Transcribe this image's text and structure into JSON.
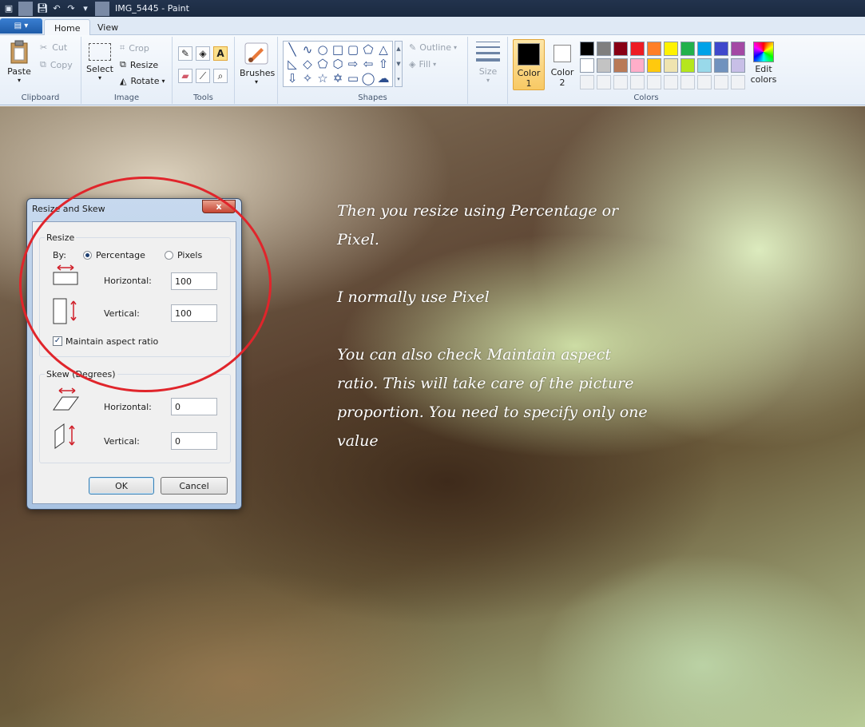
{
  "window": {
    "title": "IMG_5445 - Paint"
  },
  "tabs": [
    {
      "label": "Home"
    },
    {
      "label": "View"
    }
  ],
  "ribbon": {
    "clipboard": {
      "label": "Clipboard",
      "paste": "Paste",
      "cut": "Cut",
      "copy": "Copy"
    },
    "image": {
      "label": "Image",
      "select": "Select",
      "crop": "Crop",
      "resize": "Resize",
      "rotate": "Rotate"
    },
    "tools": {
      "label": "Tools"
    },
    "brushes": {
      "label": "Brushes"
    },
    "shapes": {
      "label": "Shapes",
      "outline": "Outline",
      "fill": "Fill"
    },
    "size": {
      "label": "Size"
    },
    "colors": {
      "label": "Colors",
      "color1": "Color",
      "color1_num": "1",
      "color2": "Color",
      "color2_num": "2",
      "edit": "Edit",
      "edit2": "colors",
      "row1": [
        "#000000",
        "#7f7f7f",
        "#880015",
        "#ed1c24",
        "#ff7f27",
        "#fff200",
        "#22b14c",
        "#00a2e8",
        "#3f48cc",
        "#a349a4"
      ],
      "row2": [
        "#ffffff",
        "#c3c3c3",
        "#b97a57",
        "#ffaec9",
        "#ffc90e",
        "#efe4b0",
        "#b5e61d",
        "#99d9ea",
        "#7092be",
        "#c8bfe7"
      ]
    }
  },
  "note": {
    "p1": "Then you resize using Percentage or Pixel.",
    "p2": "I normally use Pixel",
    "p3": "You can also check Maintain aspect ratio. This will take care of the picture proportion. You need to specify only one value"
  },
  "dialog": {
    "title": "Resize and Skew",
    "close": "x",
    "resize_group": "Resize",
    "by_label": "By:",
    "percentage": "Percentage",
    "pixels": "Pixels",
    "horizontal_label": "Horizontal:",
    "horizontal_value": "100",
    "vertical_label": "Vertical:",
    "vertical_value": "100",
    "maintain": "Maintain aspect ratio",
    "skew_group": "Skew (Degrees)",
    "skew_horizontal_label": "Horizontal:",
    "skew_horizontal_value": "0",
    "skew_vertical_label": "Vertical:",
    "skew_vertical_value": "0",
    "ok": "OK",
    "cancel": "Cancel"
  }
}
